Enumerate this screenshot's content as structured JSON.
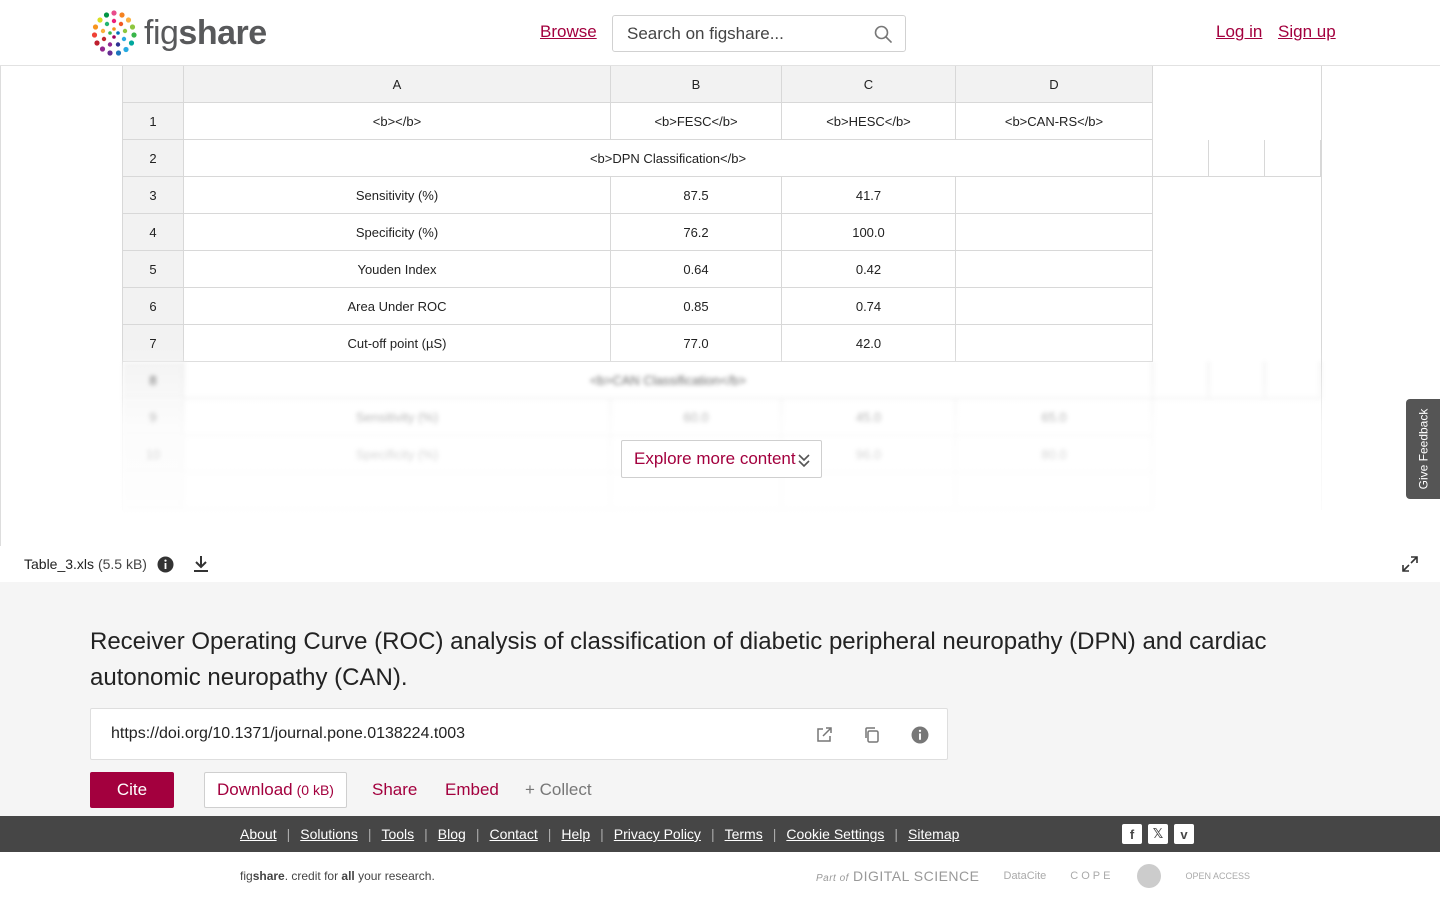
{
  "header": {
    "brand_figs": "fig",
    "brand_share": "share",
    "browse_label": "Browse",
    "search_placeholder": "Search on figshare...",
    "login_label": "Log in",
    "signup_label": "Sign up"
  },
  "sheet": {
    "column_headers": [
      "A",
      "B",
      "C",
      "D"
    ],
    "rows": [
      {
        "n": "1",
        "cells": [
          "<b></b>",
          "<b>FESC</b>",
          "<b>HESC</b>",
          "<b>CAN-RS</b>"
        ]
      },
      {
        "n": "2",
        "merged": "<b>DPN Classification</b>"
      },
      {
        "n": "3",
        "cells": [
          "Sensitivity (%)",
          "87.5",
          "41.7",
          ""
        ]
      },
      {
        "n": "4",
        "cells": [
          "Specificity (%)",
          "76.2",
          "100.0",
          ""
        ]
      },
      {
        "n": "5",
        "cells": [
          "Youden Index",
          "0.64",
          "0.42",
          ""
        ]
      },
      {
        "n": "6",
        "cells": [
          "Area Under ROC",
          "0.85",
          "0.74",
          ""
        ]
      },
      {
        "n": "7",
        "cells": [
          "Cut-off point (µS)",
          "77.0",
          "42.0",
          ""
        ]
      },
      {
        "n": "8",
        "merged": "<b>CAN Classification</b>"
      },
      {
        "n": "9",
        "cells": [
          "Sensitivity (%)",
          "60.0",
          "45.0",
          "65.0"
        ]
      },
      {
        "n": "10",
        "cells": [
          "Specificity (%)",
          "",
          "96.0",
          "80.0"
        ]
      }
    ],
    "explore_label": "Explore more content"
  },
  "feedback_label": "Give Feedback",
  "file": {
    "name": "Table_3.xls",
    "size": "(5.5 kB)"
  },
  "article": {
    "title": "Receiver Operating Curve (ROC) analysis of classification of diabetic peripheral neuropathy (DPN) and cardiac autonomic neuropathy (CAN).",
    "doi": "https://doi.org/10.1371/journal.pone.0138224.t003",
    "cite_label": "Cite",
    "download_label": "Download",
    "download_size": "(0 kB)",
    "share_label": "Share",
    "embed_label": "Embed",
    "collect_label": "+ Collect"
  },
  "footer": {
    "links": [
      "About",
      "Solutions",
      "Tools",
      "Blog",
      "Contact",
      "Help",
      "Privacy Policy",
      "Terms",
      "Cookie Settings",
      "Sitemap"
    ],
    "tagline_fig": "fig",
    "tagline_share": "share",
    "tagline_mid": ". credit for ",
    "tagline_all": "all",
    "tagline_end": " your research.",
    "partner_partof": "Part of",
    "partner_ds": "DIGITAL SCIENCE",
    "partner_datacite": "DataCite",
    "partner_cope": "COPE",
    "partner_oa": "OPEN ACCESS"
  },
  "colors": {
    "accent": "#a3003e",
    "footer_dark": "#464646",
    "article_bg": "#f5f5f5"
  }
}
